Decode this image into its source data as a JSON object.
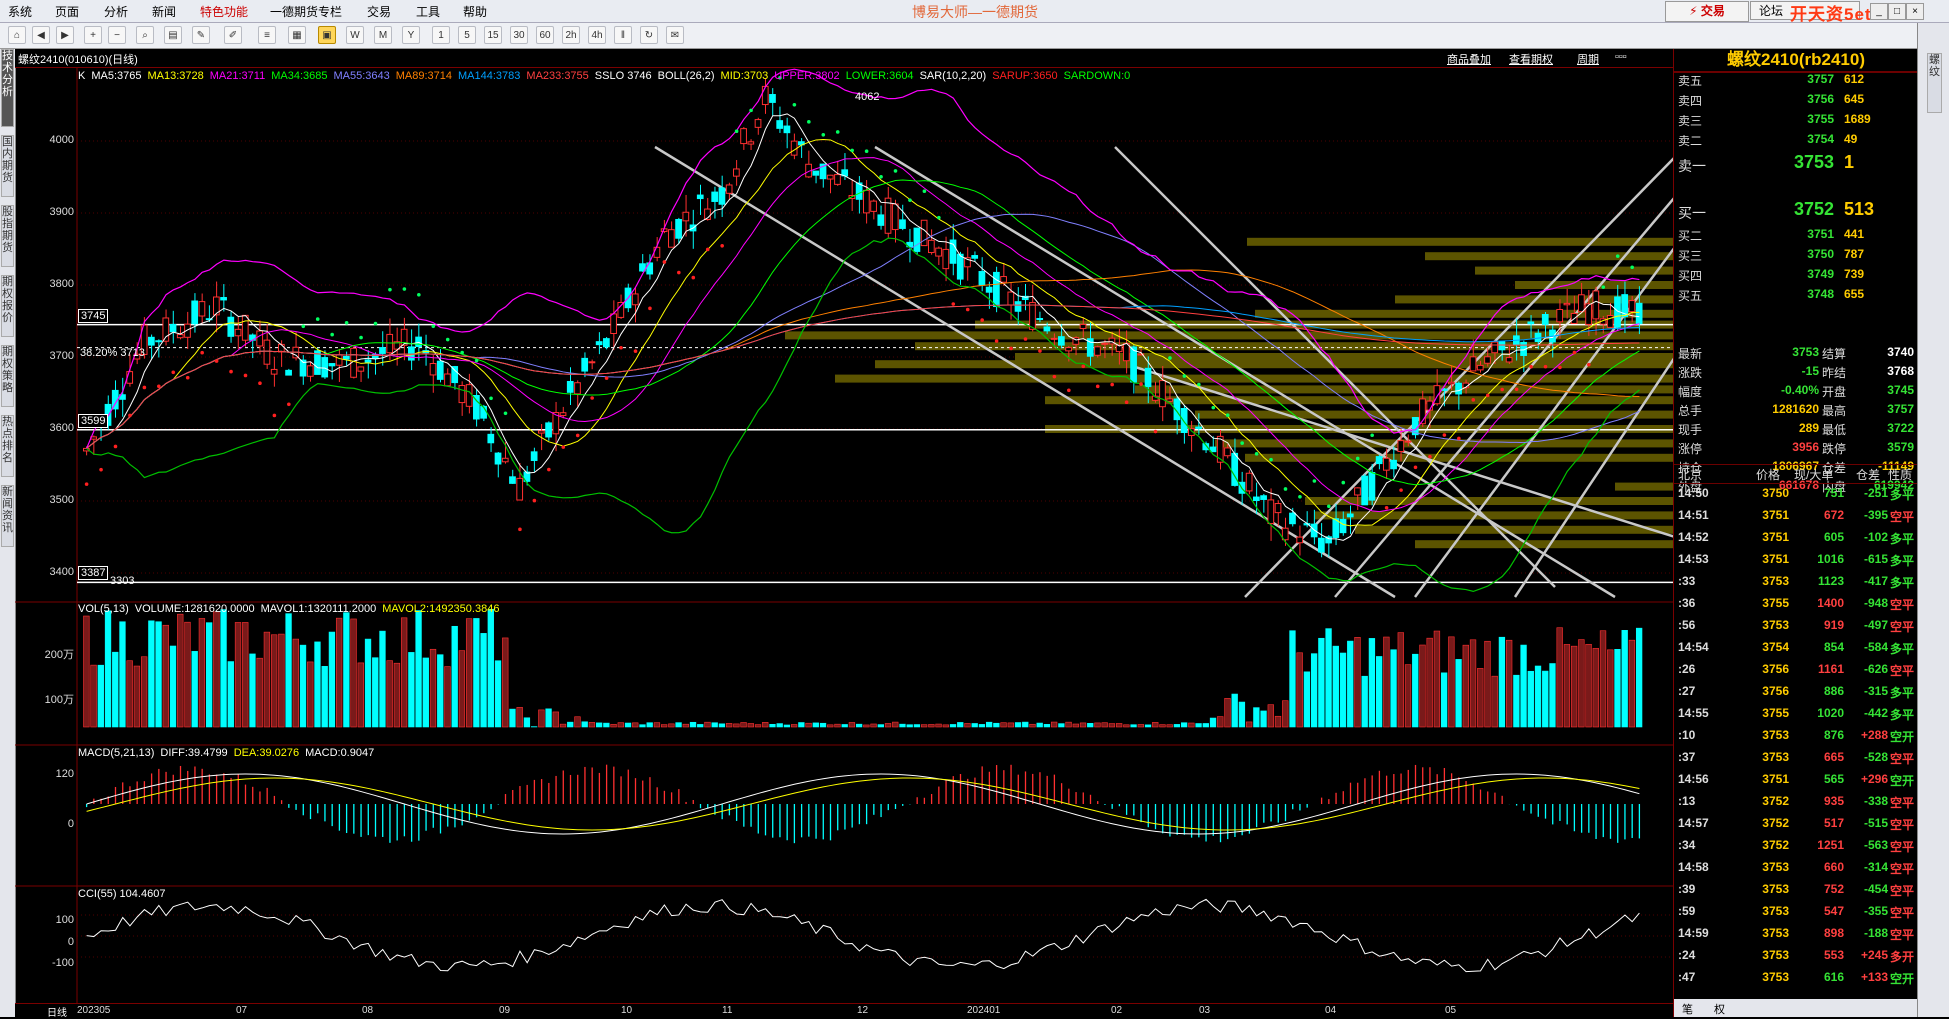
{
  "menu": {
    "items": [
      "系统",
      "页面",
      "分析",
      "新闻",
      "特色功能",
      "一德期货专栏",
      "交易",
      "工具",
      "帮助"
    ],
    "app_title": "博易大师—一德期货",
    "trade_label": "交易",
    "forum_label": "论坛",
    "watermark": "开天资5etz.com"
  },
  "toolbar": {
    "buttons": [
      "home",
      "back",
      "forward",
      "zoom-in",
      "zoom-out",
      "search",
      "chart",
      "draw",
      "list",
      "grid",
      "day",
      "week",
      "month",
      "year",
      "1",
      "5",
      "15",
      "30",
      "60",
      "2h",
      "4h",
      "pause",
      "chat"
    ],
    "active": "day"
  },
  "left_tabs": [
    "技术分析",
    "国内期货",
    "股指期货",
    "期权报价",
    "期权策略",
    "热点排名",
    "新闻资讯"
  ],
  "chart": {
    "title": "螺纹2410(010610)(日线)",
    "links": [
      "商品叠加",
      "查看期权",
      "周期"
    ],
    "period_label": "日线",
    "indicators": [
      {
        "text": "K",
        "color": "#ffffff"
      },
      {
        "text": "MA5:3765",
        "color": "#ffffff"
      },
      {
        "text": "MA13:3728",
        "color": "#ffff00"
      },
      {
        "text": "MA21:3711",
        "color": "#ff00ff"
      },
      {
        "text": "MA34:3685",
        "color": "#00ff00"
      },
      {
        "text": "MA55:3643",
        "color": "#8080ff"
      },
      {
        "text": "MA89:3714",
        "color": "#ff8000"
      },
      {
        "text": "MA144:3783",
        "color": "#00a0ff"
      },
      {
        "text": "MA233:3755",
        "color": "#ff4040"
      },
      {
        "text": "SSLO 3746",
        "color": "#ffffff"
      },
      {
        "text": "BOLL(26,2)",
        "color": "#ffffff"
      },
      {
        "text": "MID:3703",
        "color": "#ffff00"
      },
      {
        "text": "UPPER:3802",
        "color": "#ff00ff"
      },
      {
        "text": "LOWER:3604",
        "color": "#00ff00"
      },
      {
        "text": "SAR(10,2,20)",
        "color": "#ffffff"
      },
      {
        "text": "SARUP:3650",
        "color": "#ff2020"
      },
      {
        "text": "SARDOWN:0",
        "color": "#00ff00"
      }
    ],
    "y_labels": [
      "4000",
      "3900",
      "3800",
      "3700",
      "3600",
      "3500",
      "3400"
    ],
    "price_tags": {
      "hi": "4062",
      "lo": "3303",
      "box1": "3745",
      "box2": "3599",
      "box3": "3387",
      "fib": "38.20% 3713"
    },
    "x_labels": [
      "202305",
      "07",
      "08",
      "09",
      "10",
      "11",
      "12",
      "202401",
      "02",
      "03",
      "04",
      "05"
    ],
    "volume": {
      "legend": [
        {
          "text": "VOL(5,13)",
          "color": "#ffffff"
        },
        {
          "text": "VOLUME:1281620.0000",
          "color": "#ffffff"
        },
        {
          "text": "MAVOL1:1320111.2000",
          "color": "#ffffff"
        },
        {
          "text": "MAVOL2:1492350.3846",
          "color": "#ffff00"
        }
      ],
      "y_labels": [
        "200万",
        "100万"
      ]
    },
    "macd": {
      "legend": [
        {
          "text": "MACD(5,21,13)",
          "color": "#ffffff"
        },
        {
          "text": "DIFF:39.4799",
          "color": "#ffffff"
        },
        {
          "text": "DEA:39.0276",
          "color": "#ffff00"
        },
        {
          "text": "MACD:0.9047",
          "color": "#ffffff"
        }
      ],
      "y_labels": [
        "120",
        "0"
      ]
    },
    "cci": {
      "legend": [
        {
          "text": "CCI(55) 104.4607",
          "color": "#ffffff"
        }
      ],
      "y_labels": [
        "100",
        "0",
        "-100"
      ]
    }
  },
  "quote": {
    "title": "螺纹2410(rb2410)",
    "asks": [
      {
        "label": "卖五",
        "price": "3757",
        "vol": "612"
      },
      {
        "label": "卖四",
        "price": "3756",
        "vol": "645"
      },
      {
        "label": "卖三",
        "price": "3755",
        "vol": "1689"
      },
      {
        "label": "卖二",
        "price": "3754",
        "vol": "49"
      },
      {
        "label": "卖一",
        "price": "3753",
        "vol": "1"
      }
    ],
    "bids": [
      {
        "label": "买一",
        "price": "3752",
        "vol": "513"
      },
      {
        "label": "买二",
        "price": "3751",
        "vol": "441"
      },
      {
        "label": "买三",
        "price": "3750",
        "vol": "787"
      },
      {
        "label": "买四",
        "price": "3749",
        "vol": "739"
      },
      {
        "label": "买五",
        "price": "3748",
        "vol": "655"
      }
    ],
    "stats": [
      {
        "l1": "最新",
        "v1": "3753",
        "c1": "green",
        "l2": "结算",
        "v2": "3740",
        "c2": "white"
      },
      {
        "l1": "涨跌",
        "v1": "-15",
        "c1": "green",
        "l2": "昨结",
        "v2": "3768",
        "c2": "white"
      },
      {
        "l1": "幅度",
        "v1": "-0.40%",
        "c1": "green",
        "l2": "开盘",
        "v2": "3745",
        "c2": "green"
      },
      {
        "l1": "总手",
        "v1": "1281620",
        "c1": "yellow",
        "l2": "最高",
        "v2": "3757",
        "c2": "green"
      },
      {
        "l1": "现手",
        "v1": "289",
        "c1": "yellow",
        "l2": "最低",
        "v2": "3722",
        "c2": "green"
      },
      {
        "l1": "涨停",
        "v1": "3956",
        "c1": "red",
        "l2": "跌停",
        "v2": "3579",
        "c2": "green"
      },
      {
        "l1": "持仓",
        "v1": "1806967",
        "c1": "yellow",
        "l2": "仓差",
        "v2": "-11149",
        "c2": "yellow"
      },
      {
        "l1": "外盘",
        "v1": "661678",
        "c1": "red",
        "l2": "内盘",
        "v2": "619942",
        "c2": "green"
      }
    ],
    "tick_header": [
      "北京",
      "价格",
      "现/大单",
      "仓差",
      "性质"
    ],
    "ticks": [
      {
        "t": "14:50",
        "p": "3750",
        "q": "751",
        "qc": "green",
        "oi": "-251",
        "oic": "green",
        "nt": "多平",
        "ntc": "green"
      },
      {
        "t": "14:51",
        "p": "3751",
        "q": "672",
        "qc": "red",
        "oi": "-395",
        "oic": "green",
        "nt": "空平",
        "ntc": "red"
      },
      {
        "t": "14:52",
        "p": "3751",
        "q": "605",
        "qc": "green",
        "oi": "-102",
        "oic": "green",
        "nt": "多平",
        "ntc": "green"
      },
      {
        "t": "14:53",
        "p": "3751",
        "q": "1016",
        "qc": "green",
        "oi": "-615",
        "oic": "green",
        "nt": "多平",
        "ntc": "green"
      },
      {
        "t": ":33",
        "p": "3753",
        "q": "1123",
        "qc": "green",
        "oi": "-417",
        "oic": "green",
        "nt": "多平",
        "ntc": "green"
      },
      {
        "t": ":36",
        "p": "3755",
        "q": "1400",
        "qc": "red",
        "oi": "-948",
        "oic": "green",
        "nt": "空平",
        "ntc": "red"
      },
      {
        "t": ":56",
        "p": "3753",
        "q": "919",
        "qc": "red",
        "oi": "-497",
        "oic": "green",
        "nt": "空平",
        "ntc": "red"
      },
      {
        "t": "14:54",
        "p": "3754",
        "q": "854",
        "qc": "green",
        "oi": "-584",
        "oic": "green",
        "nt": "多平",
        "ntc": "green"
      },
      {
        "t": ":26",
        "p": "3756",
        "q": "1161",
        "qc": "red",
        "oi": "-626",
        "oic": "green",
        "nt": "空平",
        "ntc": "red"
      },
      {
        "t": ":27",
        "p": "3756",
        "q": "886",
        "qc": "green",
        "oi": "-315",
        "oic": "green",
        "nt": "多平",
        "ntc": "green"
      },
      {
        "t": "14:55",
        "p": "3755",
        "q": "1020",
        "qc": "green",
        "oi": "-442",
        "oic": "green",
        "nt": "多平",
        "ntc": "green"
      },
      {
        "t": ":10",
        "p": "3753",
        "q": "876",
        "qc": "green",
        "oi": "+288",
        "oic": "red",
        "nt": "空开",
        "ntc": "green"
      },
      {
        "t": ":37",
        "p": "3753",
        "q": "665",
        "qc": "red",
        "oi": "-528",
        "oic": "green",
        "nt": "空平",
        "ntc": "red"
      },
      {
        "t": "14:56",
        "p": "3751",
        "q": "565",
        "qc": "green",
        "oi": "+296",
        "oic": "red",
        "nt": "空开",
        "ntc": "green"
      },
      {
        "t": ":13",
        "p": "3752",
        "q": "935",
        "qc": "red",
        "oi": "-338",
        "oic": "green",
        "nt": "空平",
        "ntc": "red"
      },
      {
        "t": "14:57",
        "p": "3752",
        "q": "517",
        "qc": "red",
        "oi": "-515",
        "oic": "green",
        "nt": "空平",
        "ntc": "red"
      },
      {
        "t": ":34",
        "p": "3752",
        "q": "1251",
        "qc": "red",
        "oi": "-563",
        "oic": "green",
        "nt": "空平",
        "ntc": "red"
      },
      {
        "t": "14:58",
        "p": "3753",
        "q": "660",
        "qc": "red",
        "oi": "-314",
        "oic": "green",
        "nt": "空平",
        "ntc": "red"
      },
      {
        "t": ":39",
        "p": "3753",
        "q": "752",
        "qc": "red",
        "oi": "-454",
        "oic": "green",
        "nt": "空平",
        "ntc": "red"
      },
      {
        "t": ":59",
        "p": "3753",
        "q": "547",
        "qc": "red",
        "oi": "-355",
        "oic": "green",
        "nt": "空平",
        "ntc": "red"
      },
      {
        "t": "14:59",
        "p": "3753",
        "q": "898",
        "qc": "red",
        "oi": "-188",
        "oic": "green",
        "nt": "空平",
        "ntc": "red"
      },
      {
        "t": ":24",
        "p": "3753",
        "q": "553",
        "qc": "red",
        "oi": "+245",
        "oic": "red",
        "nt": "多开",
        "ntc": "red"
      },
      {
        "t": ":47",
        "p": "3753",
        "q": "616",
        "qc": "green",
        "oi": "+133",
        "oic": "red",
        "nt": "空开",
        "ntc": "green"
      }
    ],
    "footer": [
      "笔",
      "权"
    ]
  },
  "right_tabs": [
    "螺纹"
  ],
  "colors": {
    "up": "#ff3030",
    "down": "#00ffff",
    "ma_yellow": "#ffff00",
    "bg": "#000000"
  }
}
